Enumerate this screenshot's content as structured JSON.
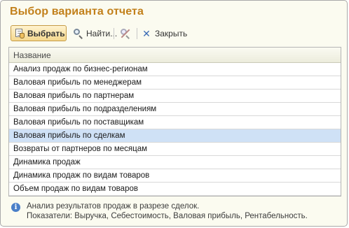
{
  "window": {
    "title": "Выбор варианта отчета"
  },
  "toolbar": {
    "select_label": "Выбрать",
    "find_label": "Найти...",
    "close_label": "Закрыть"
  },
  "list": {
    "header": "Название",
    "items": [
      "Анализ продаж по бизнес-регионам",
      "Валовая прибыль по менеджерам",
      "Валовая прибыль по партнерам",
      "Валовая прибыль по подразделениям",
      "Валовая прибыль по поставщикам",
      "Валовая прибыль по сделкам",
      "Возвраты от партнеров по месяцам",
      "Динамика продаж",
      "Динамика продаж по видам товаров",
      "Объем продаж по видам товаров"
    ],
    "selected_index": 5
  },
  "info": {
    "line1": "Анализ результатов продаж в разрезе сделок.",
    "line2": "Показатели: Выручка, Себестоимость, Валовая прибыль, Рентабельность."
  },
  "colors": {
    "title": "#c2801b",
    "selected_row": "#cfe1f6",
    "primary_button": "#f5d88e"
  }
}
